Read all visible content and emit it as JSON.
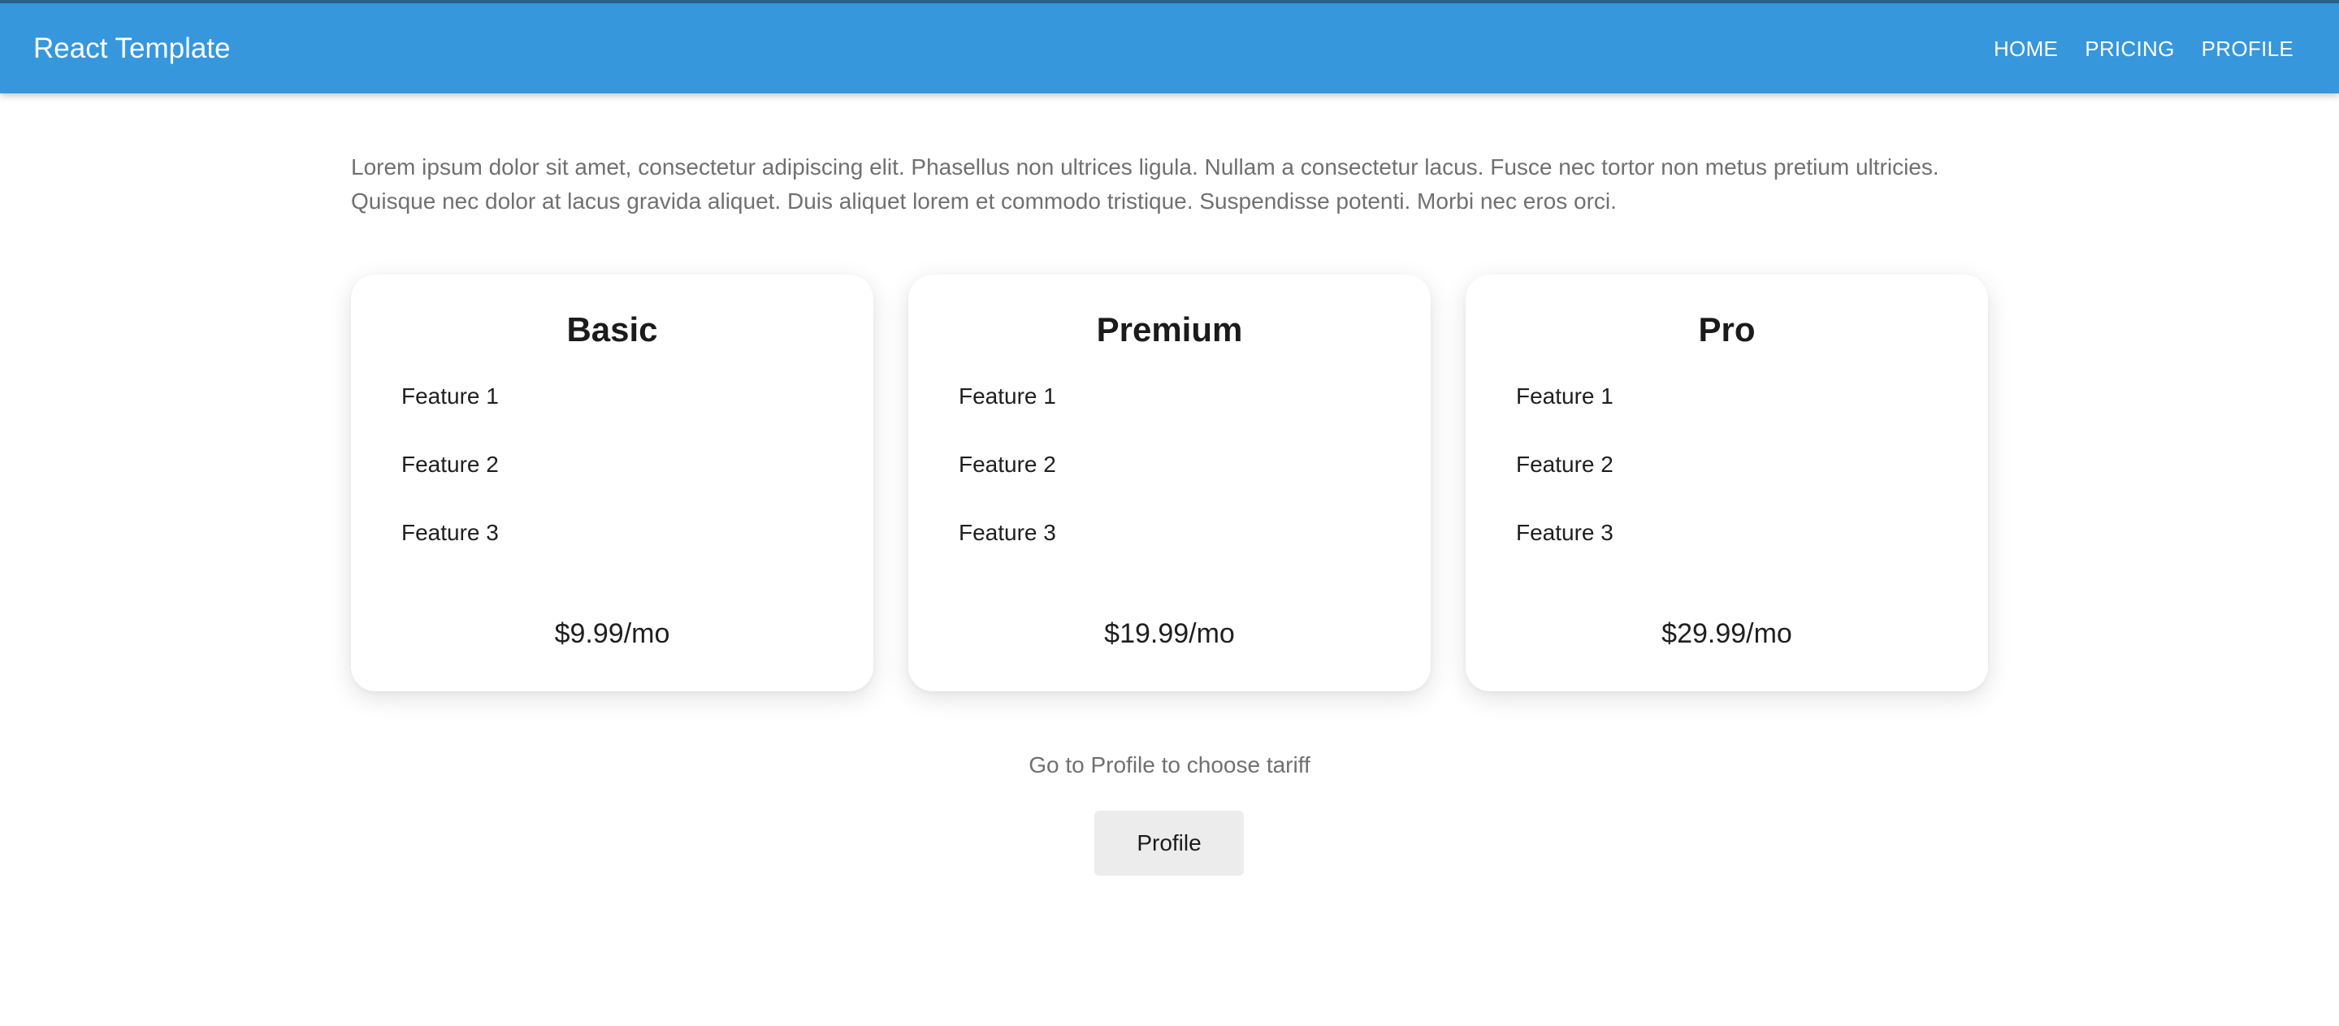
{
  "header": {
    "brand": "React Template",
    "nav": [
      "HOME",
      "PRICING",
      "PROFILE"
    ],
    "background_color": "#3697dd"
  },
  "intro_text": "Lorem ipsum dolor sit amet, consectetur adipiscing elit. Phasellus non ultrices ligula. Nullam a consectetur lacus. Fusce nec tortor non metus pretium ultricies. Quisque nec dolor at lacus gravida aliquet. Duis aliquet lorem et commodo tristique. Suspendisse potenti. Morbi nec eros orci.",
  "plans": [
    {
      "name": "Basic",
      "features": [
        "Feature 1",
        "Feature 2",
        "Feature 3"
      ],
      "price": "$9.99/mo"
    },
    {
      "name": "Premium",
      "features": [
        "Feature 1",
        "Feature 2",
        "Feature 3"
      ],
      "price": "$19.99/mo"
    },
    {
      "name": "Pro",
      "features": [
        "Feature 1",
        "Feature 2",
        "Feature 3"
      ],
      "price": "$29.99/mo"
    }
  ],
  "hint": "Go to Profile to choose tariff",
  "profile_button": "Profile"
}
